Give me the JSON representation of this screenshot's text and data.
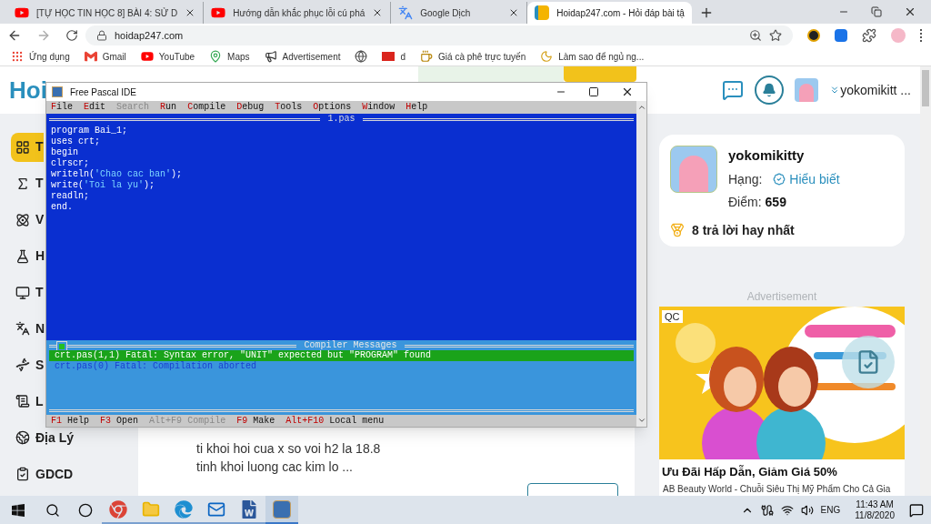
{
  "browser": {
    "tabs": [
      {
        "kind": "youtube",
        "title": "[TỰ HỌC TIN HỌC 8] BÀI 4: SỬ D",
        "selected": false
      },
      {
        "kind": "youtube",
        "title": "Hướng dẫn khắc phục lỗi cú phá",
        "selected": false
      },
      {
        "kind": "translate",
        "title": "Google Dịch",
        "selected": false
      },
      {
        "kind": "site",
        "title": "Hoidap247.com - Hỏi đáp bài tậ",
        "selected": true
      }
    ],
    "address": "hoidap247.com",
    "bookmarks": [
      {
        "kind": "apps",
        "label": "Ứng dụng"
      },
      {
        "kind": "gmail",
        "label": "Gmail"
      },
      {
        "kind": "youtube",
        "label": "YouTube"
      },
      {
        "kind": "maps",
        "label": "Maps"
      },
      {
        "kind": "ad",
        "label": "Advertisement"
      },
      {
        "kind": "globe"
      },
      {
        "kind": "vn",
        "label": "d"
      },
      {
        "kind": "coffee",
        "label": "Giá cà phê trực tuyến"
      },
      {
        "kind": "sleep",
        "label": "Làm sao để ngủ ng..."
      }
    ]
  },
  "site": {
    "logo": "Hoi",
    "user": "yokomikitt ...",
    "sidebar": [
      {
        "kind": "grid",
        "label": "T",
        "selected": true
      },
      {
        "kind": "math",
        "label": "T",
        "selected": false
      },
      {
        "kind": "atom",
        "label": "V",
        "selected": false
      },
      {
        "kind": "flask",
        "label": "H",
        "selected": false
      },
      {
        "kind": "monitor",
        "label": "T",
        "selected": false
      },
      {
        "kind": "lang",
        "label": "N",
        "selected": false
      },
      {
        "kind": "dna",
        "label": "S",
        "selected": false
      },
      {
        "kind": "scroll",
        "label": "L",
        "selected": false
      },
      {
        "kind": "earth",
        "label": "Địa Lý",
        "selected": false
      },
      {
        "kind": "civics",
        "label": "GDCD",
        "selected": false
      }
    ],
    "question_lines": [
      "ti khoi hoi cua x so voi h2 la 18.8",
      "tinh khoi luong cac kim lo ..."
    ],
    "profile": {
      "name": "yokomikitty",
      "rank_label": "Hạng:",
      "rank": "Hiểu biết",
      "points_label": "Điểm:",
      "points": "659",
      "best_answers": "8 trả lời hay nhất"
    },
    "ad": {
      "heading": "Advertisement",
      "badge": "QC",
      "title": "Ưu Đãi Hấp Dẫn, Giảm Giá 50%",
      "description": "AB Beauty World - Chuỗi Siêu Thị Mỹ Phẩm Cho Cả Gia"
    }
  },
  "ide": {
    "title": "Free Pascal IDE",
    "menu": [
      {
        "key": "F",
        "rest": "ile",
        "disabled": false
      },
      {
        "key": "E",
        "rest": "dit",
        "disabled": false
      },
      {
        "key": "S",
        "rest": "earch",
        "disabled": true
      },
      {
        "key": "R",
        "rest": "un",
        "disabled": false
      },
      {
        "key": "C",
        "rest": "ompile",
        "disabled": false
      },
      {
        "key": "D",
        "rest": "ebug",
        "disabled": false
      },
      {
        "key": "T",
        "rest": "ools",
        "disabled": false
      },
      {
        "key": "O",
        "rest": "ptions",
        "disabled": false
      },
      {
        "key": "W",
        "rest": "indow",
        "disabled": false
      },
      {
        "key": "H",
        "rest": "elp",
        "disabled": false
      }
    ],
    "editor_title": "1.pas",
    "code": [
      [
        {
          "kind": "code",
          "text": "program Bai_1;"
        }
      ],
      [
        {
          "kind": "code",
          "text": "uses crt;"
        }
      ],
      [
        {
          "kind": "code",
          "text": "begin"
        }
      ],
      [
        {
          "kind": "code",
          "text": "clrscr;"
        }
      ],
      [
        {
          "kind": "code",
          "text": "writeln("
        },
        {
          "kind": "string",
          "text": "'Chao cac ban'"
        },
        {
          "kind": "code",
          "text": ");"
        }
      ],
      [
        {
          "kind": "code",
          "text": "write("
        },
        {
          "kind": "string",
          "text": "'Toi la yu'"
        },
        {
          "kind": "code",
          "text": ");"
        }
      ],
      [
        {
          "kind": "code",
          "text": "readln;"
        }
      ],
      [
        {
          "kind": "code",
          "text": "end."
        }
      ]
    ],
    "messages_title": "Compiler Messages",
    "messages": [
      {
        "text": "crt.pas(1,1) Fatal: Syntax error, \"UNIT\" expected but \"PROGRAM\" found",
        "selected": true
      },
      {
        "text": "crt.pas(0) Fatal: Compilation aborted",
        "selected": false
      }
    ],
    "status": [
      {
        "key": "F1",
        "label": "Help",
        "disabled": false
      },
      {
        "key": "F3",
        "label": "Open",
        "disabled": false
      },
      {
        "key": "Alt+F9",
        "label": "Compile",
        "disabled": true
      },
      {
        "key": "F9",
        "label": "Make",
        "disabled": false
      },
      {
        "key": "Alt+F10",
        "label": "Local menu",
        "disabled": false
      }
    ]
  },
  "taskbar": {
    "apps": [
      {
        "kind": "chrome",
        "selected": false
      },
      {
        "kind": "folder",
        "selected": false
      },
      {
        "kind": "edge",
        "selected": false
      },
      {
        "kind": "mail",
        "selected": false
      },
      {
        "kind": "word",
        "selected": false
      },
      {
        "kind": "fpc",
        "selected": true
      }
    ],
    "language": "ENG",
    "time": "11:43 AM",
    "date": "11/8/2020"
  }
}
